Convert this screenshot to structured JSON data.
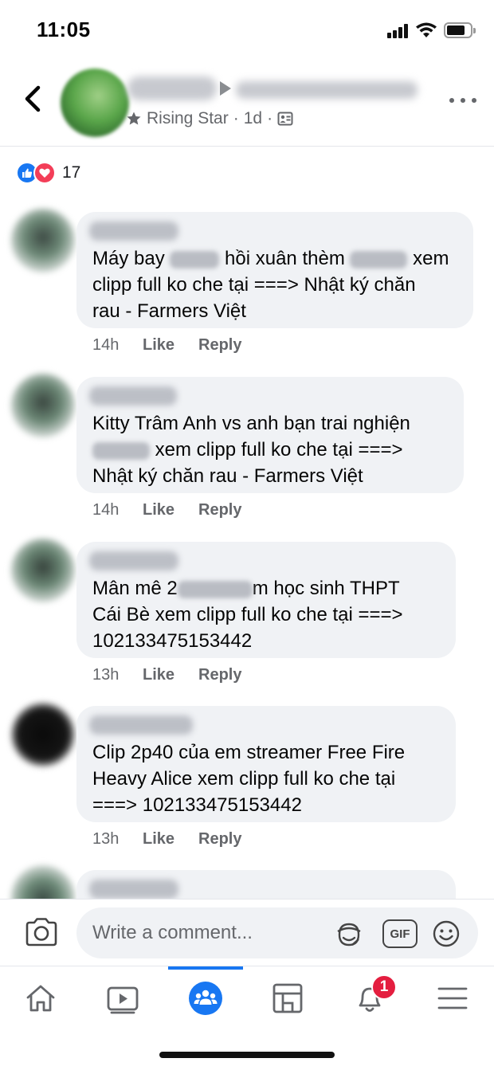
{
  "status_bar": {
    "time": "11:05"
  },
  "header": {
    "badge_label": "Rising Star",
    "separator": "·",
    "age": "1d"
  },
  "reactions": {
    "count": "17"
  },
  "comments": [
    {
      "time": "14h",
      "like": "Like",
      "reply": "Reply",
      "segments": [
        "Máy bay ",
        " hồi xuân thèm ",
        " xem",
        "clipp full ko che tại ===> Nhật ký chăn",
        "rau - Farmers Việt"
      ]
    },
    {
      "time": "14h",
      "like": "Like",
      "reply": "Reply",
      "segments": [
        "Kitty Trâm Anh vs anh bạn trai nghiện",
        " xem clipp full ko che tại ===>",
        "Nhật ký chăn rau - Farmers Việt"
      ]
    },
    {
      "time": "13h",
      "like": "Like",
      "reply": "Reply",
      "segments": [
        "Mân mê 2",
        "m học sinh THPT",
        "Cái Bè xem clipp full ko che tại ===>",
        "102133475153442"
      ]
    },
    {
      "time": "13h",
      "like": "Like",
      "reply": "Reply",
      "segments": [
        "Clip 2p40 của em streamer Free Fire",
        "Heavy Alice xem clipp full ko che tại",
        "===> 102133475153442"
      ]
    }
  ],
  "composer": {
    "placeholder": "Write a comment...",
    "gif_label": "GIF"
  },
  "tabbar": {
    "notifications_badge": "1",
    "active_tab": "groups"
  },
  "colors": {
    "accent": "#1877f2",
    "bubble": "#f0f2f5",
    "badge": "#e41e3f",
    "secondary_text": "#65676b"
  }
}
